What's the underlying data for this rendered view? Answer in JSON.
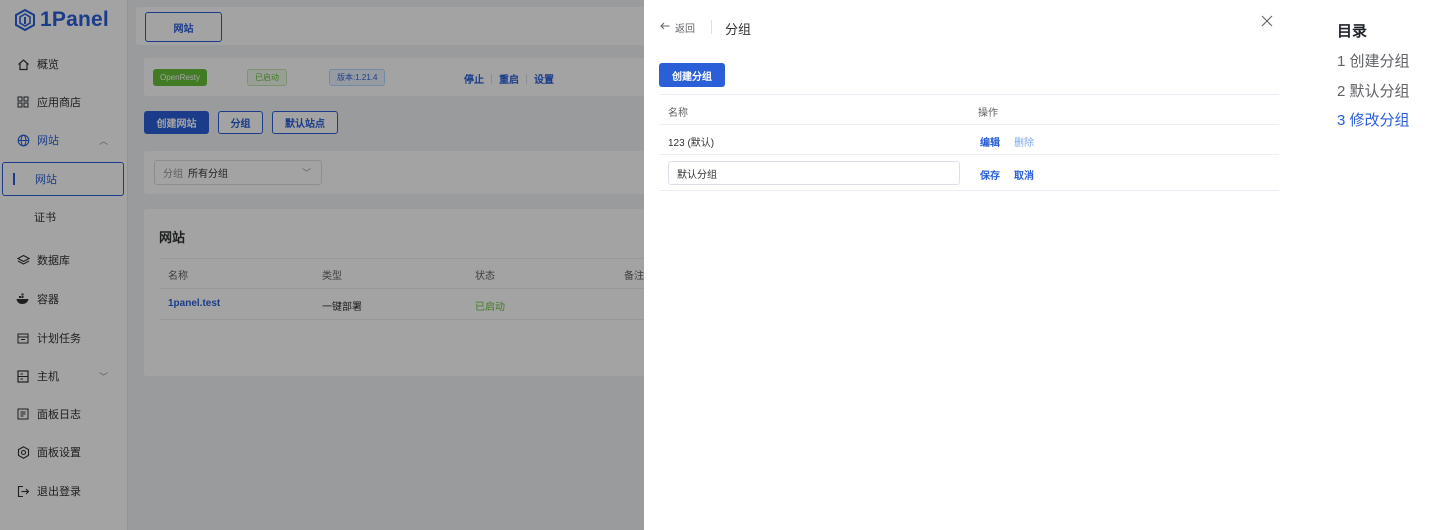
{
  "brand": {
    "name": "1Panel"
  },
  "sidebar": {
    "items": [
      {
        "label": "概览",
        "icon": "home-icon"
      },
      {
        "label": "应用商店",
        "icon": "apps-grid-icon"
      },
      {
        "label": "网站",
        "icon": "globe-icon"
      },
      {
        "label": "网站"
      },
      {
        "label": "证书"
      },
      {
        "label": "数据库",
        "icon": "database-icon"
      },
      {
        "label": "容器",
        "icon": "docker-icon"
      },
      {
        "label": "计划任务",
        "icon": "calendar-icon"
      },
      {
        "label": "主机",
        "icon": "host-icon"
      },
      {
        "label": "面板日志",
        "icon": "log-icon"
      },
      {
        "label": "面板设置",
        "icon": "settings-gear-icon"
      },
      {
        "label": "退出登录",
        "icon": "logout-icon"
      }
    ]
  },
  "main": {
    "top_tab": "网站",
    "status_bar": {
      "app_name": "OpenResty",
      "status": "已启动",
      "version": "版本:1.21.4",
      "actions": [
        "停止",
        "重启",
        "设置"
      ]
    },
    "toolbar": {
      "create": "创建网站",
      "group": "分组",
      "default_site": "默认站点"
    },
    "filter": {
      "label": "分组",
      "value": "所有分组"
    },
    "sites": {
      "title": "网站",
      "columns": [
        "名称",
        "类型",
        "状态",
        "备注"
      ],
      "rows": [
        {
          "name": "1panel.test",
          "type": "一键部署",
          "status": "已启动"
        }
      ]
    }
  },
  "drawer": {
    "back": "返回",
    "title": "分组",
    "create_button": "创建分组",
    "columns": [
      "名称",
      "操作"
    ],
    "rows": [
      {
        "name": "123 (默认)",
        "actions": [
          "编辑",
          "删除"
        ]
      }
    ],
    "edit_row": {
      "input_value": "默认分组",
      "actions": [
        "保存",
        "取消"
      ]
    }
  },
  "toc": {
    "title": "目录",
    "items": [
      "1 创建分组",
      "2 默认分组",
      "3 修改分组"
    ],
    "current_index": 2
  },
  "colors": {
    "primary": "#2a5fd8",
    "success": "#67c23a",
    "overlay": "rgba(0,0,0,0.36)"
  }
}
